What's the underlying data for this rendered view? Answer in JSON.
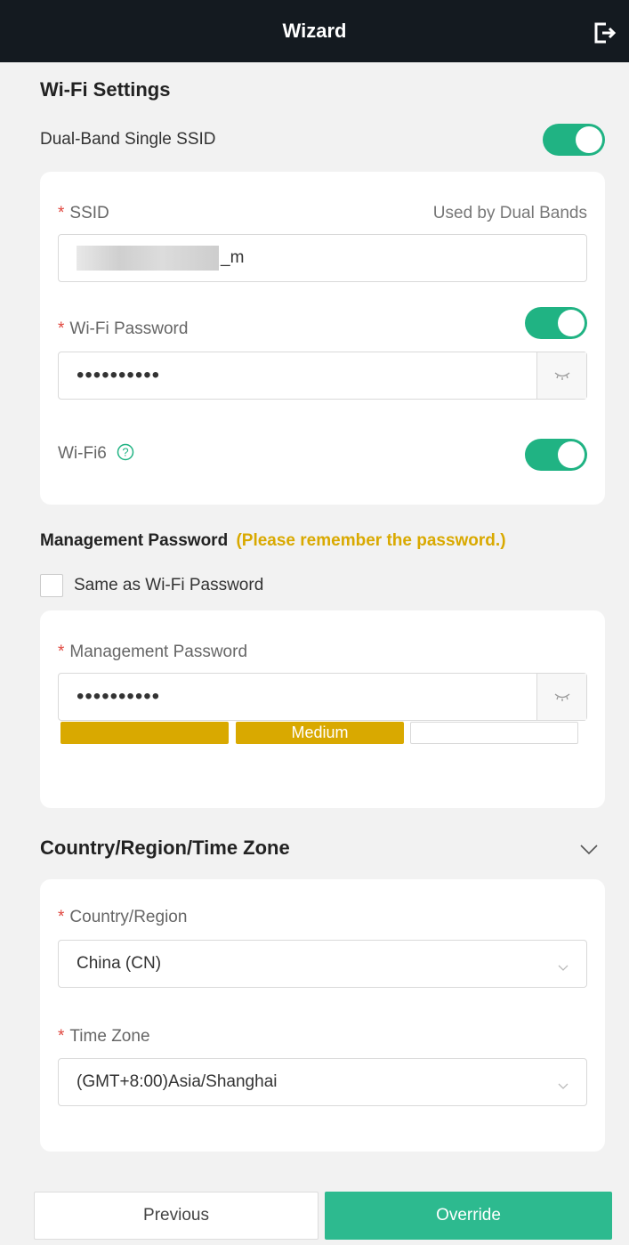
{
  "header": {
    "title": "Wizard"
  },
  "wifi_settings": {
    "title": "Wi-Fi Settings",
    "dual_band_label": "Dual-Band Single SSID",
    "ssid_label": "SSID",
    "ssid_hint": "Used by Dual Bands",
    "ssid_suffix": "_m",
    "password_label": "Wi-Fi Password",
    "password_mask": "••••••••••",
    "wifi6_label": "Wi-Fi6"
  },
  "management": {
    "title": "Management Password",
    "note": "(Please remember the password.)",
    "same_as_label": "Same as Wi-Fi Password",
    "password_label": "Management Password",
    "password_mask": "••••••••••",
    "strength_text": "Medium"
  },
  "region": {
    "title": "Country/Region/Time Zone",
    "country_label": "Country/Region",
    "country_value": "China (CN)",
    "timezone_label": "Time Zone",
    "timezone_value": "(GMT+8:00)Asia/Shanghai"
  },
  "footer": {
    "previous_label": "Previous",
    "override_label": "Override"
  },
  "colors": {
    "accent": "#20b383",
    "warning": "#d9a900",
    "header": "#141a20",
    "required": "#e0463e"
  }
}
